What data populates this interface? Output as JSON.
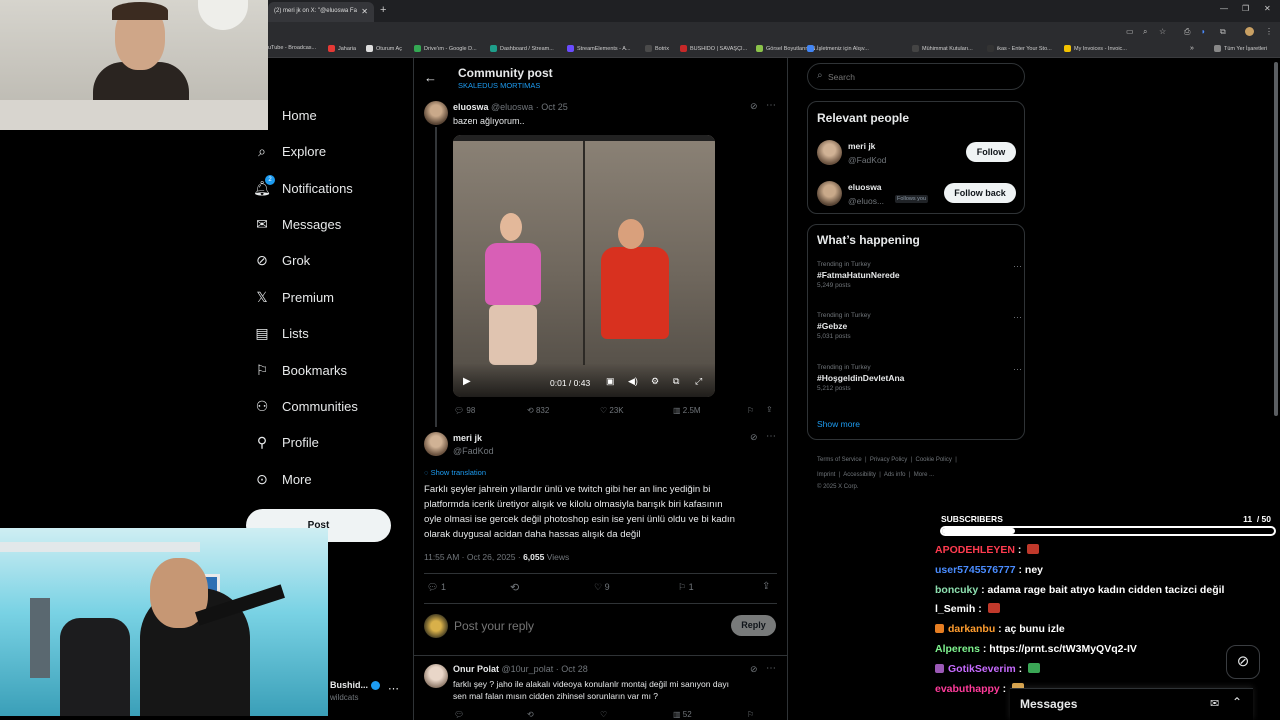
{
  "browser": {
    "tab_title": "(2) meri jk on X: \"@eluoswa Fa",
    "bookmarks": [
      "uTube - Broadcas...",
      "Jaharia",
      "Oturum Aç",
      "Drive'ım - Google D...",
      "Dashboard / Stream...",
      "StreamElements - A...",
      "Botrix",
      "BUSHIDO | SAVAŞÇI...",
      "Görsel Boyutlarını N...",
      "İşletmeniz için Alışv...",
      "Mühimmat Kutuları...",
      "ikas - Enter Your Sto...",
      "My Invoices - Invoic...",
      "Tüm Yer İşaretleri"
    ]
  },
  "nav": {
    "items": [
      "Home",
      "Explore",
      "Notifications",
      "Messages",
      "Grok",
      "Premium",
      "Lists",
      "Bookmarks",
      "Communities",
      "Profile",
      "More"
    ],
    "notif_badge": "2",
    "post_label": "Post"
  },
  "header": {
    "title": "Community post",
    "community": "SKALEDUS MORTIMAS"
  },
  "tweet1": {
    "name": "eluoswa",
    "handle": "@eluoswa",
    "date": "Oct 25",
    "text": "bazen ağlıyorum..",
    "video_time": "0:01 / 0:43",
    "replies": "98",
    "retweets": "832",
    "likes": "23K",
    "views": "2.5M"
  },
  "tweet2": {
    "name": "meri jk",
    "handle": "@FadKod",
    "show_translation": "Show translation",
    "lines": [
      "Farklı şeyler jahrein yıllardır ünlü ve twitch gibi her an linc yediğin bi",
      "platformda icerik üretiyor alışık ve kilolu olmasiyla barışık biri kafasının",
      "oyle olmasi ise gercek değil photoshop esin ise yeni ünlü oldu ve bi kadın",
      "olarak duygusal acidan daha hassas alışık da değil"
    ],
    "time": "11:55 AM · Oct 26, 2025 · ",
    "views_count": "6,055",
    "views_label": " Views",
    "replies": "1",
    "likes": "9",
    "bookmarks": "1"
  },
  "reply_box": {
    "placeholder": "Post your reply",
    "button": "Reply"
  },
  "tweet3": {
    "name": "Onur Polat",
    "handle": "@10ur_polat",
    "date": "Oct 28",
    "lines": [
      "farklı şey ? jaho ile alakalı videoya konulanlr montaj değil mi sanıyon dayı",
      "sen mal falan mısın cidden zihinsel sorunların var mı ?"
    ],
    "views": "52"
  },
  "left_account": {
    "name": "Bushid...",
    "handle": "wildcats"
  },
  "search": {
    "placeholder": "Search"
  },
  "relevant": {
    "title": "Relevant people",
    "people": [
      {
        "name": "meri jk",
        "handle": "@FadKod",
        "button": "Follow"
      },
      {
        "name": "eluoswa",
        "handle": "@eluos...",
        "badge": "Follows you",
        "button": "Follow back"
      }
    ]
  },
  "happening": {
    "title": "What’s happening",
    "trends": [
      {
        "context": "Trending in Turkey",
        "tag": "#FatmaHatunNerede",
        "posts": "5,249 posts"
      },
      {
        "context": "Trending in Turkey",
        "tag": "#Gebze",
        "posts": "5,031 posts"
      },
      {
        "context": "Trending in Turkey",
        "tag": "#HoşgeldinDevletAna",
        "posts": "5,212 posts"
      }
    ],
    "show_more": "Show more"
  },
  "footer": {
    "links": [
      "Terms of Service",
      "Privacy Policy",
      "Cookie Policy",
      "Imprint",
      "Accessibility",
      "Ads info",
      "More ..."
    ],
    "copyright": "© 2025 X Corp."
  },
  "overlay": {
    "subscribers_label": "SUBSCRIBERS",
    "subscribers_current": "11",
    "subscribers_goal": "/ 50",
    "subscribers_progress": 0.22
  },
  "chat": [
    {
      "user": "APODEHLEYEN",
      "color": "#ff3b4f",
      "msg": "",
      "emote": "#c0392b"
    },
    {
      "user": "user5745576777",
      "color": "#4a8cff",
      "msg": "ney",
      "emote": ""
    },
    {
      "user": "boncuky",
      "color": "#8ee0b0",
      "msg": "adama rage bait atıyo kadın cidden tacizci değil",
      "emote": ""
    },
    {
      "user": "l_Semih",
      "color": "#ffffff",
      "msg": "",
      "emote": "#c0392b"
    },
    {
      "user": "darkanbu",
      "color": "#ff9d2f",
      "msg": "aç bunu izle",
      "emote": ""
    },
    {
      "user": "Alperens",
      "color": "#7ef28e",
      "msg": "https://prnt.sc/tW3MyQVq2-IV",
      "emote": ""
    },
    {
      "user": "GotikSeverim",
      "color": "#c76bff",
      "msg": "",
      "emote": "#3aa655"
    },
    {
      "user": "evabuthappy",
      "color": "#ff3b9a",
      "msg": "",
      "emote": "#d4a04a"
    }
  ],
  "messages_dock": {
    "label": "Messages"
  },
  "colors": {
    "accent": "#1d9bf0",
    "bg": "#000000",
    "text": "#e7e9ea",
    "muted": "#71767b"
  }
}
